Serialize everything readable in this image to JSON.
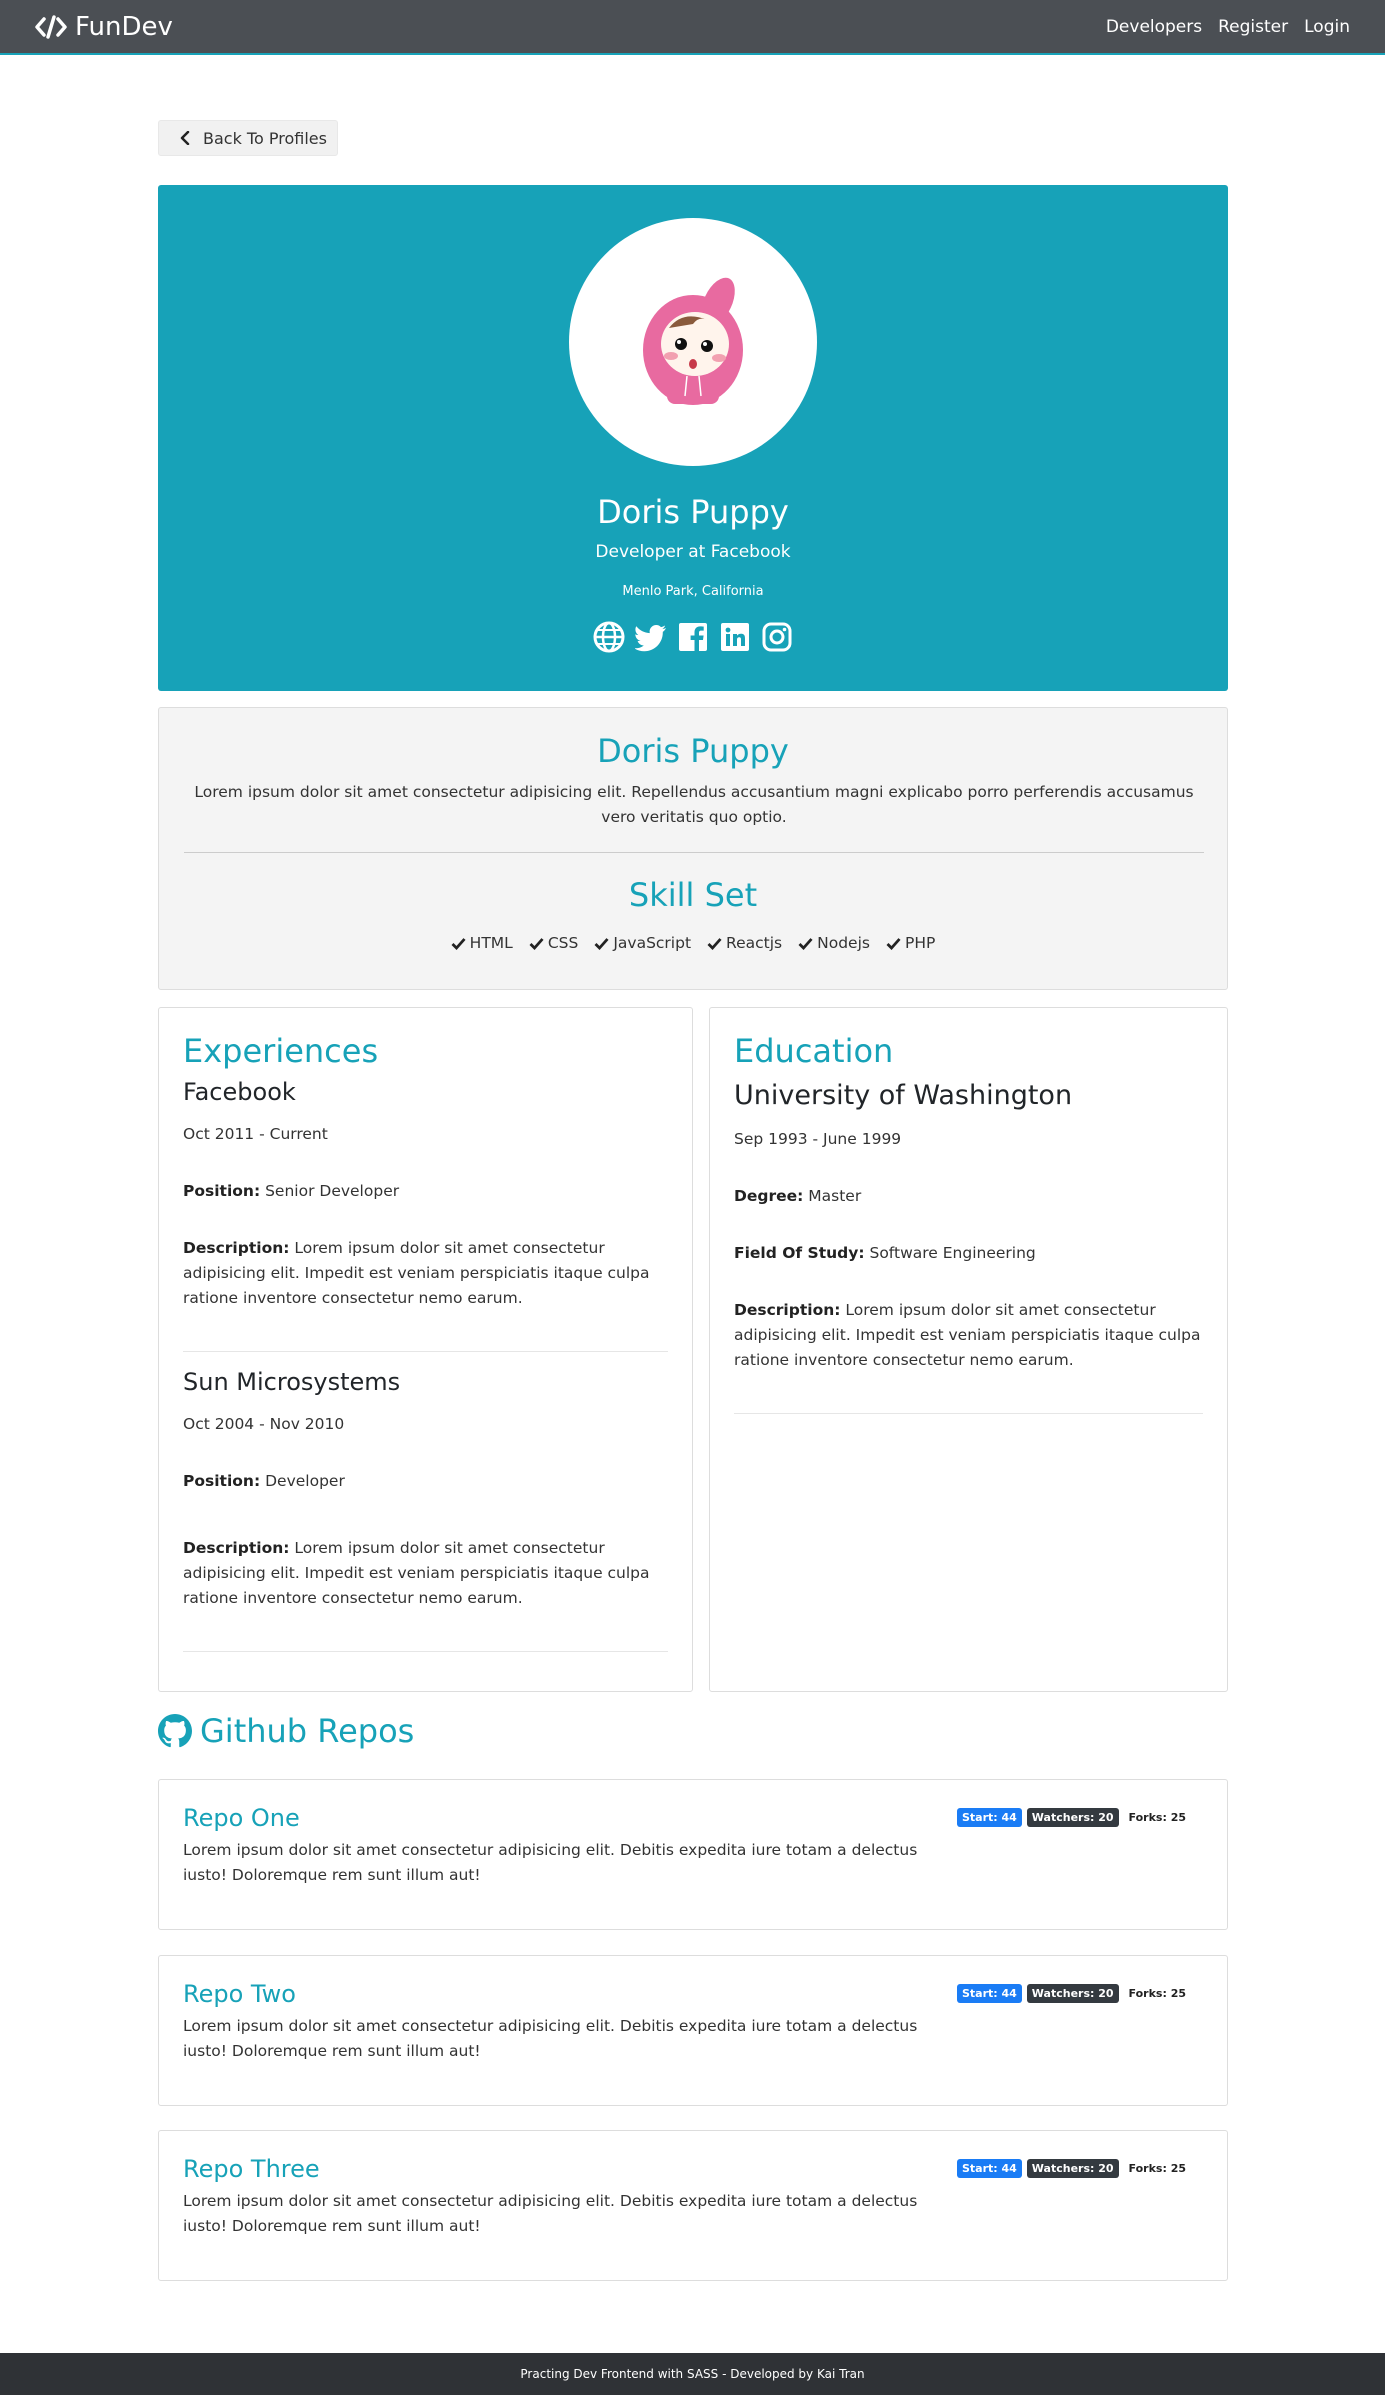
{
  "navbar": {
    "brand": "FunDev",
    "links": [
      "Developers",
      "Register",
      "Login"
    ]
  },
  "back_button": "Back To Profiles",
  "profile_top": {
    "name": "Doris Puppy",
    "status": "Developer at Facebook",
    "location": "Menlo Park, California",
    "socials": [
      "globe-icon",
      "twitter-icon",
      "facebook-icon",
      "linkedin-icon",
      "instagram-icon"
    ]
  },
  "profile_about": {
    "name": "Doris Puppy",
    "bio": "Lorem ipsum dolor sit amet consectetur adipisicing elit. Repellendus accusantium magni explicabo porro perferendis accusamus vero veritatis quo optio.",
    "skill_title": "Skill Set",
    "skills": [
      "HTML",
      "CSS",
      "JavaScript",
      "Reactjs",
      "Nodejs",
      "PHP"
    ]
  },
  "experiences": {
    "title": "Experiences",
    "items": [
      {
        "company": "Facebook",
        "dates": "Oct 2011 - Current",
        "position_label": "Position:",
        "position": "Senior Developer",
        "description_label": "Description:",
        "description": "Lorem ipsum dolor sit amet consectetur adipisicing elit. Impedit est veniam perspiciatis itaque culpa ratione inventore consectetur nemo earum."
      },
      {
        "company": "Sun Microsystems",
        "dates": "Oct 2004 - Nov 2010",
        "position_label": "Position:",
        "position": "Developer",
        "description_label": "Description:",
        "description": "Lorem ipsum dolor sit amet consectetur adipisicing elit. Impedit est veniam perspiciatis itaque culpa ratione inventore consectetur nemo earum."
      }
    ]
  },
  "education": {
    "title": "Education",
    "items": [
      {
        "school": "University of Washington",
        "dates": "Sep 1993 - June 1999",
        "degree_label": "Degree:",
        "degree": "Master",
        "field_label": "Field Of Study:",
        "field": "Software Engineering",
        "description_label": "Description:",
        "description": "Lorem ipsum dolor sit amet consectetur adipisicing elit. Impedit est veniam perspiciatis itaque culpa ratione inventore consectetur nemo earum."
      }
    ]
  },
  "github": {
    "title": "Github Repos",
    "repos": [
      {
        "name": "Repo One",
        "description": "Lorem ipsum dolor sit amet consectetur adipisicing elit. Debitis expedita iure totam a delectus iusto! Doloremque rem sunt illum aut!",
        "stars": "Start: 44",
        "watchers": "Watchers: 20",
        "forks": "Forks: 25"
      },
      {
        "name": "Repo Two",
        "description": "Lorem ipsum dolor sit amet consectetur adipisicing elit. Debitis expedita iure totam a delectus iusto! Doloremque rem sunt illum aut!",
        "stars": "Start: 44",
        "watchers": "Watchers: 20",
        "forks": "Forks: 25"
      },
      {
        "name": "Repo Three",
        "description": "Lorem ipsum dolor sit amet consectetur adipisicing elit. Debitis expedita iure totam a delectus iusto! Doloremque rem sunt illum aut!",
        "stars": "Start: 44",
        "watchers": "Watchers: 20",
        "forks": "Forks: 25"
      }
    ]
  },
  "footer": "Practing Dev Frontend with SASS - Developed by Kai Tran",
  "colors": {
    "accent": "#17a2b8",
    "navbar": "#4b4f54",
    "footer": "#2f3236",
    "badge_primary": "#1a7cf5",
    "badge_dark": "#343a40"
  }
}
